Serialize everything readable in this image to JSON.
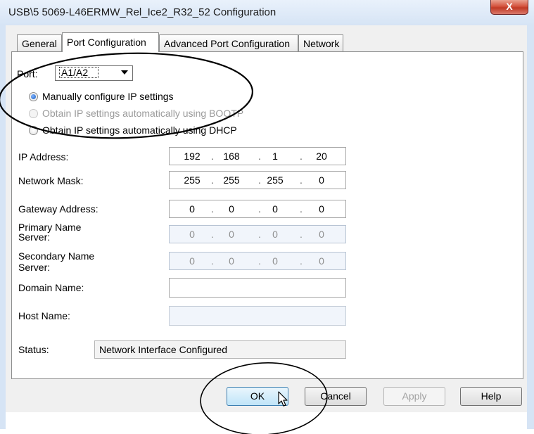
{
  "window": {
    "title": "USB\\5 5069-L46ERMW_Rel_Ice2_R32_52 Configuration",
    "close_glyph": "X"
  },
  "tabs": [
    {
      "label": "General",
      "active": false
    },
    {
      "label": "Port Configuration",
      "active": true
    },
    {
      "label": "Advanced Port Configuration",
      "active": false
    },
    {
      "label": "Network",
      "active": false
    }
  ],
  "port": {
    "label": "Port:",
    "value": "A1/A2"
  },
  "ip_mode": {
    "manual": {
      "label": "Manually configure IP settings",
      "selected": true,
      "enabled": true
    },
    "bootp": {
      "label": "Obtain IP settings automatically using BOOTP",
      "selected": false,
      "enabled": false
    },
    "dhcp": {
      "label": "Obtain IP settings automatically using DHCP",
      "selected": false,
      "enabled": true
    }
  },
  "fields": {
    "ip_address": {
      "label": "IP Address:",
      "octets": [
        "192",
        "168",
        "1",
        "20"
      ],
      "enabled": true
    },
    "network_mask": {
      "label": "Network Mask:",
      "octets": [
        "255",
        "255",
        "255",
        "0"
      ],
      "enabled": true
    },
    "gateway": {
      "label": "Gateway Address:",
      "octets": [
        "0",
        "0",
        "0",
        "0"
      ],
      "enabled": true
    },
    "primary_ns": {
      "label_line1": "Primary Name",
      "label_line2": "Server:",
      "octets": [
        "0",
        "0",
        "0",
        "0"
      ],
      "enabled": false
    },
    "secondary_ns": {
      "label_line1": "Secondary Name",
      "label_line2": "Server:",
      "octets": [
        "0",
        "0",
        "0",
        "0"
      ],
      "enabled": false
    },
    "domain_name": {
      "label": "Domain Name:",
      "value": ""
    },
    "host_name": {
      "label": "Host Name:",
      "value": ""
    }
  },
  "status": {
    "label": "Status:",
    "value": "Network Interface Configured"
  },
  "buttons": {
    "ok": "OK",
    "cancel": "Cancel",
    "apply": "Apply",
    "help": "Help"
  },
  "annotations": {
    "stroke_color": "#000000"
  }
}
